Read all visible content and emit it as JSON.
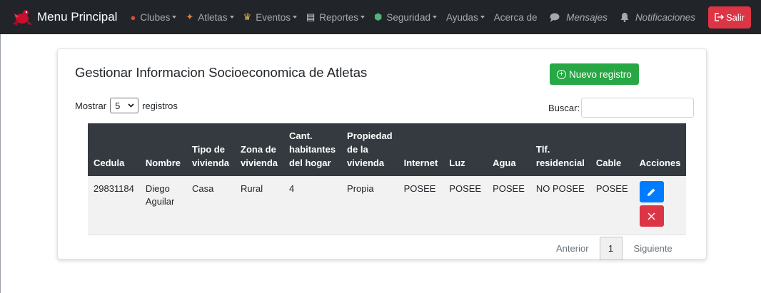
{
  "navbar": {
    "brand": "Menu Principal",
    "items": [
      {
        "label": "Clubes",
        "icon": "boxing-glove-icon",
        "dropdown": true
      },
      {
        "label": "Atletas",
        "icon": "athlete-icon",
        "dropdown": true
      },
      {
        "label": "Eventos",
        "icon": "trophy-icon",
        "dropdown": true
      },
      {
        "label": "Reportes",
        "icon": "document-icon",
        "dropdown": true
      },
      {
        "label": "Seguridad",
        "icon": "shield-icon",
        "dropdown": true
      },
      {
        "label": "Ayudas",
        "dropdown": true
      },
      {
        "label": "Acerca de",
        "dropdown": false
      }
    ],
    "mensajes": "Mensajes",
    "notificaciones": "Notificaciones",
    "salir": "Salir"
  },
  "page": {
    "title": "Gestionar Informacion Socioeconomica de Atletas",
    "new_button": "Nuevo registro",
    "length_prefix": "Mostrar",
    "length_value": "5",
    "length_suffix": "registros",
    "search_label": "Buscar:",
    "search_value": ""
  },
  "table": {
    "headers": [
      "Cedula",
      "Nombre",
      "Tipo de vivienda",
      "Zona de vivienda",
      "Cant. habitantes del hogar",
      "Propiedad de la vivienda",
      "Internet",
      "Luz",
      "Agua",
      "Tlf. residencial",
      "Cable",
      "Acciones"
    ],
    "rows": [
      {
        "cedula": "29831184",
        "nombre": "Diego Aguilar",
        "tipo": "Casa",
        "zona": "Rural",
        "cant": "4",
        "propiedad": "Propia",
        "internet": "POSEE",
        "luz": "POSEE",
        "agua": "POSEE",
        "tlf": "NO POSEE",
        "cable": "POSEE"
      }
    ]
  },
  "pagination": {
    "previous": "Anterior",
    "current": "1",
    "next": "Siguiente"
  },
  "colors": {
    "navbar": "#212529",
    "thead": "#343a40",
    "success": "#28a745",
    "primary": "#007bff",
    "danger": "#dc3545"
  }
}
